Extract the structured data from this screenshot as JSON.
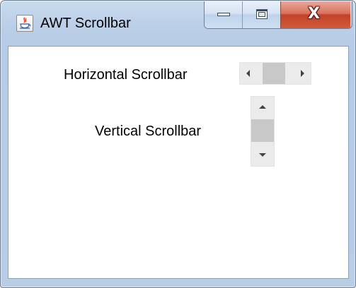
{
  "window": {
    "title": "AWT Scrollbar",
    "app_icon": "java-coffee-cup-icon",
    "caption_buttons": {
      "minimize_icon": "minimize-icon",
      "maximize_icon": "maximize-icon",
      "close_icon": "close-icon",
      "close_glyph": "X"
    },
    "colors": {
      "frame": "#b9cde5",
      "close_button": "#c2412a",
      "client_background": "#ffffff",
      "scrollbar_track": "#ebebeb",
      "scrollbar_thumb": "#c8c8c8"
    }
  },
  "content": {
    "horizontal_label": "Horizontal Scrollbar",
    "vertical_label": "Vertical Scrollbar",
    "horizontal_scrollbar": {
      "left_arrow_icon": "arrow-left-icon",
      "right_arrow_icon": "arrow-right-icon",
      "thumb_position": 0.0
    },
    "vertical_scrollbar": {
      "up_arrow_icon": "arrow-up-icon",
      "down_arrow_icon": "arrow-down-icon",
      "thumb_position": 0.0
    }
  }
}
